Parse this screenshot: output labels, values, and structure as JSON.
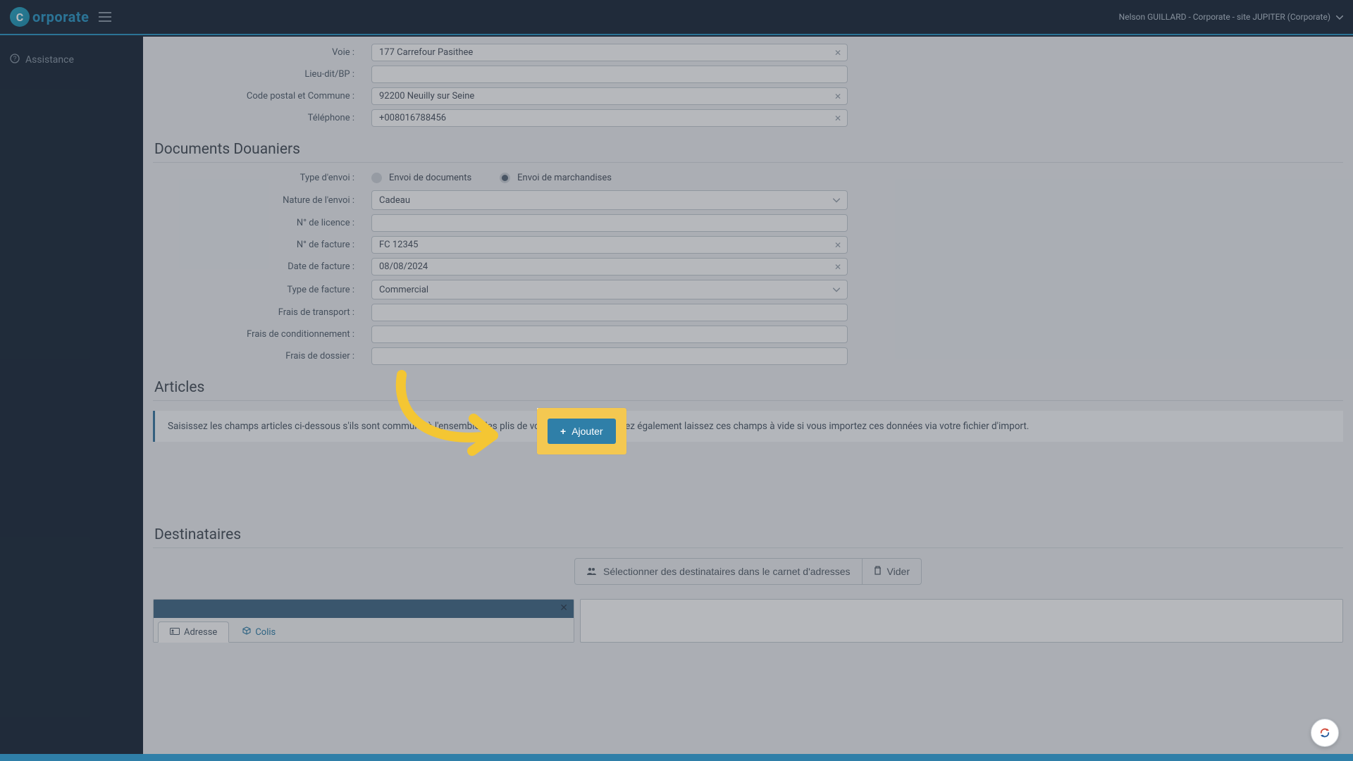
{
  "brand": {
    "mark": "C",
    "name": "orporate"
  },
  "user_line": "Nelson GUILLARD - Corporate - site JUPITER (Corporate)",
  "sidebar": {
    "assistance": "Assistance"
  },
  "address": {
    "voie_label": "Voie :",
    "voie_value": "177 Carrefour Pasithee",
    "lieudit_label": "Lieu-dit/BP :",
    "lieudit_value": "",
    "cp_label": "Code postal et Commune :",
    "cp_value": "92200 Neuilly sur Seine",
    "tel_label": "Téléphone :",
    "tel_value": "+008016788456"
  },
  "customs": {
    "heading": "Documents Douaniers",
    "type_envoi_label": "Type d'envoi :",
    "radio_docs": "Envoi de documents",
    "radio_marchandises": "Envoi de marchandises",
    "nature_label": "Nature de l'envoi :",
    "nature_value": "Cadeau",
    "licence_label": "N° de licence :",
    "licence_value": "",
    "facture_label": "N° de facture :",
    "facture_value": "FC 12345",
    "date_facture_label": "Date de facture :",
    "date_facture_value": "08/08/2024",
    "type_facture_label": "Type de facture :",
    "type_facture_value": "Commercial",
    "frais_transport_label": "Frais de transport :",
    "frais_cond_label": "Frais de conditionnement :",
    "frais_dossier_label": "Frais de dossier :"
  },
  "articles": {
    "heading": "Articles",
    "info": "Saisissez les champs articles ci-dessous s'ils sont communs à l'ensemble des plis de votre envoi. Vous pouvez également laissez ces champs à vide si vous importez ces données via votre fichier d'import.",
    "add_label": "Ajouter"
  },
  "dest": {
    "heading": "Destinataires",
    "select_label": "Sélectionner des destinataires dans le carnet d'adresses",
    "vider_label": "Vider",
    "tab_adresse": "Adresse",
    "tab_colis": "Colis"
  }
}
